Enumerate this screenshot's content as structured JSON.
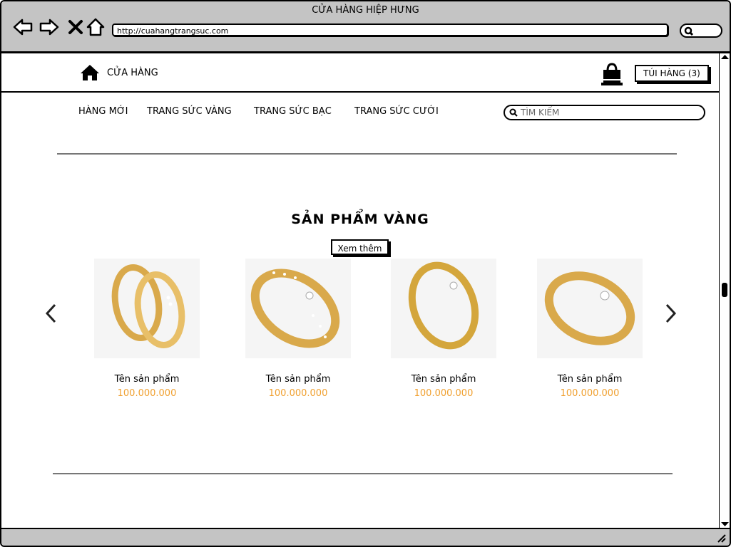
{
  "window": {
    "title": "CỬA HÀNG HIỆP HƯNG",
    "url": "http://cuahangtrangsuc.com"
  },
  "header": {
    "brand": "CỬA HÀNG",
    "cart_label": "TÚI HÀNG (3)"
  },
  "menu": [
    "HÀNG MỚI",
    "TRANG SỨC VÀNG",
    "TRANG SỨC BẠC",
    "TRANG SỨC CƯỚI"
  ],
  "search": {
    "placeholder": "TÌM KIẾM"
  },
  "section": {
    "title": "SẢN PHẨM VÀNG",
    "more_label": "Xem thêm"
  },
  "products": [
    {
      "name": "Tên sản phẩm",
      "price": "100.000.000"
    },
    {
      "name": "Tên sản phẩm",
      "price": "100.000.000"
    },
    {
      "name": "Tên sản phẩm",
      "price": "100.000.000"
    },
    {
      "name": "Tên sản phẩm",
      "price": "100.000.000"
    }
  ],
  "colors": {
    "price": "#f0a030",
    "gold": "#d9a94b",
    "chrome": "#c4c4c4"
  }
}
